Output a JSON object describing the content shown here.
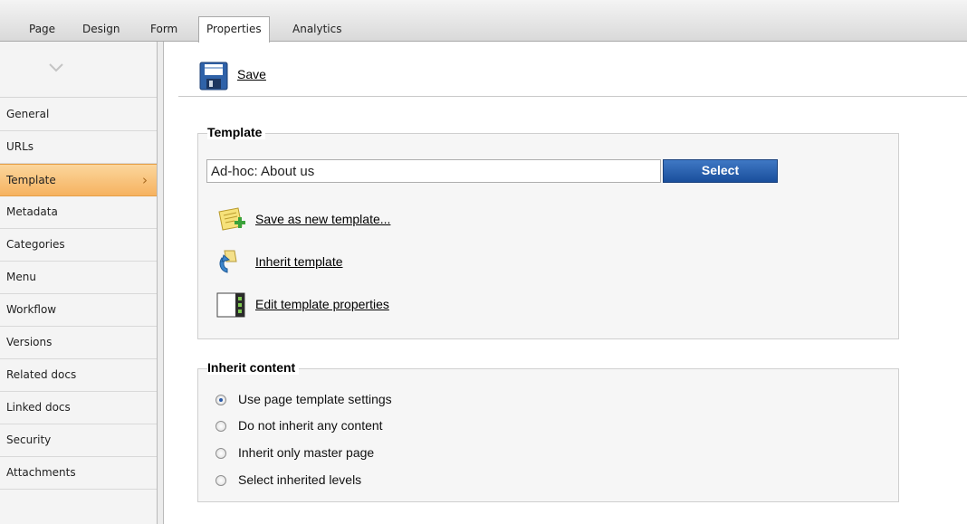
{
  "tabs": [
    {
      "label": "Page",
      "active": false
    },
    {
      "label": "Design",
      "active": false
    },
    {
      "label": "Form",
      "active": false
    },
    {
      "label": "Properties",
      "active": true
    },
    {
      "label": "Analytics",
      "active": false
    }
  ],
  "sidebar": {
    "collapse_icon": "chevron-down-icon",
    "items": [
      {
        "label": "General",
        "selected": false
      },
      {
        "label": "URLs",
        "selected": false
      },
      {
        "label": "Template",
        "selected": true
      },
      {
        "label": "Metadata",
        "selected": false
      },
      {
        "label": "Categories",
        "selected": false
      },
      {
        "label": "Menu",
        "selected": false
      },
      {
        "label": "Workflow",
        "selected": false
      },
      {
        "label": "Versions",
        "selected": false
      },
      {
        "label": "Related docs",
        "selected": false
      },
      {
        "label": "Linked docs",
        "selected": false
      },
      {
        "label": "Security",
        "selected": false
      },
      {
        "label": "Attachments",
        "selected": false
      }
    ],
    "selected_arrow": "›"
  },
  "toolbar": {
    "save_label": "Save",
    "save_icon": "floppy-disk-icon"
  },
  "template_section": {
    "legend": "Template",
    "input_value": "Ad-hoc: About us",
    "select_button": "Select",
    "actions": [
      {
        "label": "Save as new template...",
        "icon": "save-template-icon"
      },
      {
        "label": "Inherit template",
        "icon": "inherit-icon"
      },
      {
        "label": "Edit template properties",
        "icon": "edit-properties-icon"
      }
    ]
  },
  "inherit_section": {
    "legend": "Inherit content",
    "options": [
      {
        "label": "Use page template settings",
        "checked": true
      },
      {
        "label": "Do not inherit any content",
        "checked": false
      },
      {
        "label": "Inherit only master page",
        "checked": false
      },
      {
        "label": "Select inherited levels",
        "checked": false
      }
    ]
  },
  "colors": {
    "selected_item": "#f6b260",
    "select_button": "#1a4f9c",
    "tab_bar": "#d9d9d9"
  }
}
